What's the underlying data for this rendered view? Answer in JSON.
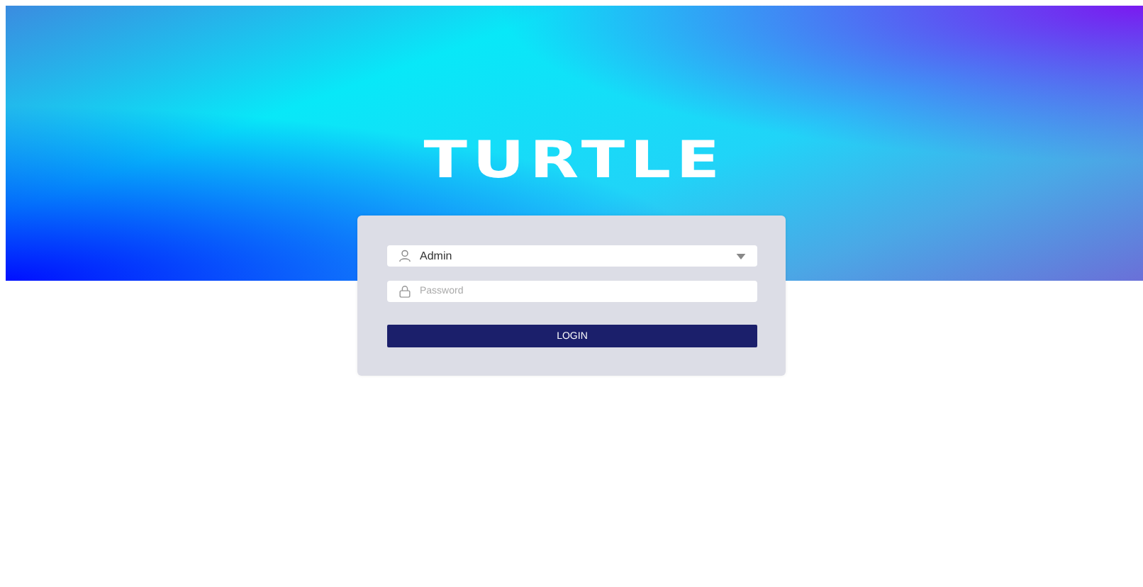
{
  "logo": "TURTLE",
  "login_form": {
    "user": {
      "value": "Admin"
    },
    "password": {
      "placeholder": "Password"
    },
    "button": "LOGIN"
  }
}
